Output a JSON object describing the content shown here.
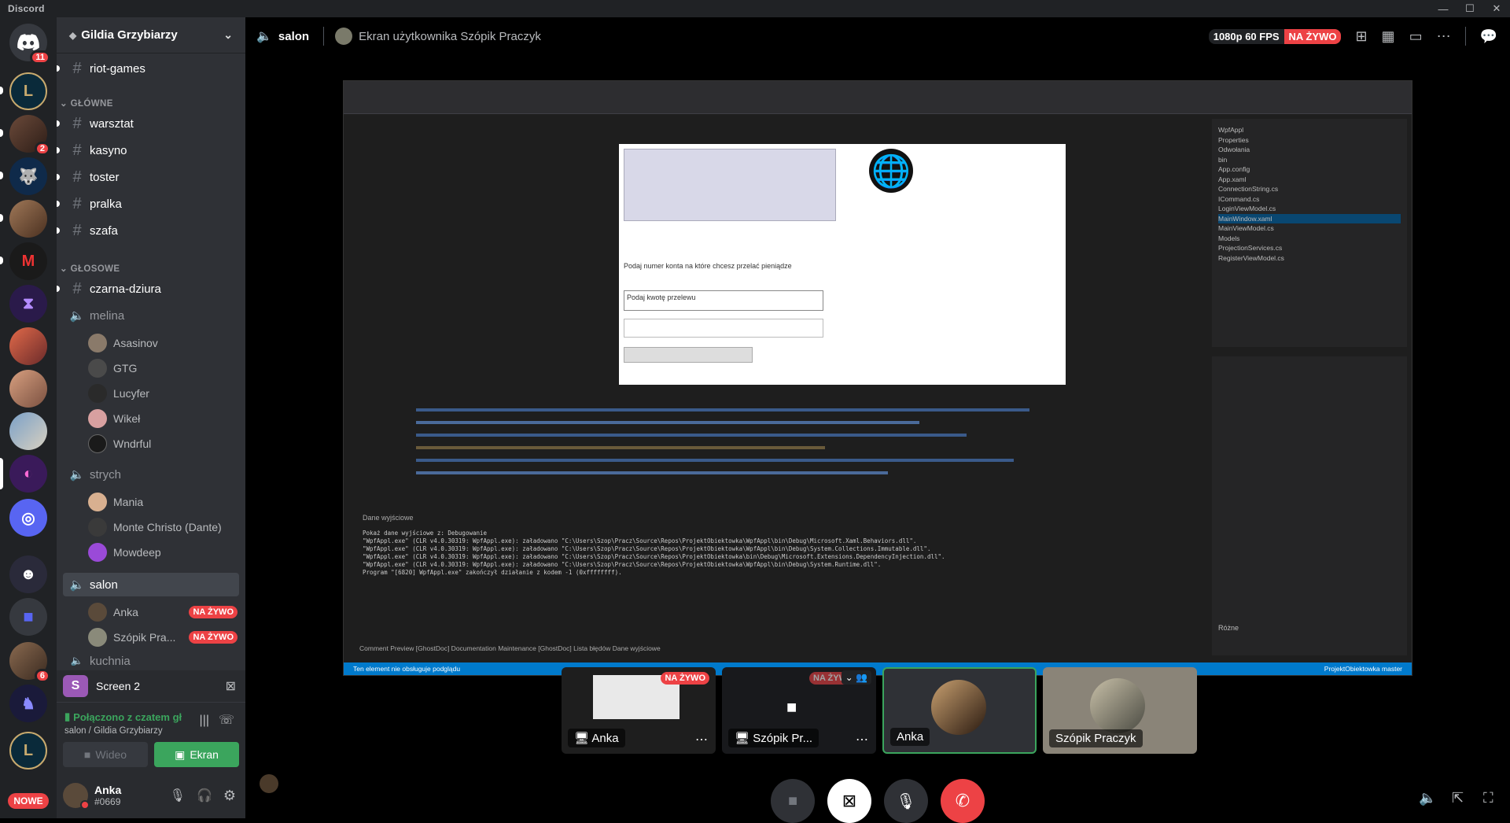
{
  "app": {
    "title": "Discord"
  },
  "guilds": {
    "home_badge": "11",
    "badge_2": "2",
    "badge_6": "6",
    "new_label": "NOWE"
  },
  "server": {
    "name": "Gildia Grzybiarzy"
  },
  "channels": {
    "top": [
      {
        "name": "riot-games"
      }
    ],
    "cat_main": "GŁÓWNE",
    "main": [
      {
        "name": "warsztat"
      },
      {
        "name": "kasyno"
      },
      {
        "name": "toster"
      },
      {
        "name": "pralka"
      },
      {
        "name": "szafa"
      }
    ],
    "cat_voice": "GŁOSOWE",
    "voice_text": {
      "name": "czarna-dziura"
    },
    "melina": {
      "name": "melina",
      "users": [
        "Asasinov",
        "GTG",
        "Lucyfer",
        "Wikeł",
        "Wndrful"
      ]
    },
    "strych": {
      "name": "strych",
      "users": [
        "Mania",
        "Monte Christo (Dante)",
        "Mowdeep"
      ]
    },
    "salon": {
      "name": "salon",
      "users": [
        {
          "name": "Anka",
          "live": "NA ŻYWO"
        },
        {
          "name": "Szópik Pra...",
          "live": "NA ŻYWO"
        }
      ]
    },
    "cut": "kuchnia"
  },
  "screen_share": {
    "title": "Screen 2",
    "icon_letter": "S"
  },
  "voice": {
    "status": "Połączono z czatem gł",
    "location": "salon / Gildia Grzybiarzy",
    "video_label": "Wideo",
    "screen_label": "Ekran"
  },
  "user": {
    "name": "Anka",
    "tag": "#0669"
  },
  "topbar": {
    "channel": "salon",
    "stream_title": "Ekran użytkownika Szópik Praczyk",
    "quality": "1080p 60 FPS",
    "live": "NA ŻYWO"
  },
  "tiles": [
    {
      "name": "Anka",
      "live": "NA ŻYWO"
    },
    {
      "name": "Szópik Pr...",
      "live": "NA ŻYW"
    },
    {
      "name": "Anka"
    },
    {
      "name": "Szópik Praczyk"
    }
  ],
  "stream_content": {
    "prompt1": "Podaj numer konta na które chcesz przelać pieniądze",
    "prompt2": "Podaj kwotę przelewu",
    "output_title": "Dane wyjściowe",
    "output_lines": [
      "Pokaż dane wyjściowe z: Debugowanie",
      "\"WpfAppl.exe\" (CLR v4.0.30319: WpfAppl.exe): załadowano \"C:\\Users\\Szop\\Pracz\\Source\\Repos\\ProjektObiektowka\\WpfAppl\\bin\\Debug\\Microsoft.Xaml.Behaviors.dll\".",
      "\"WpfAppl.exe\" (CLR v4.0.30319: WpfAppl.exe): załadowano \"C:\\Users\\Szop\\Pracz\\Source\\Repos\\ProjektObiektowka\\WpfAppl\\bin\\Debug\\System.Collections.Immutable.dll\".",
      "\"WpfAppl.exe\" (CLR v4.0.30319: WpfAppl.exe): załadowano \"C:\\Users\\Szop\\Pracz\\Source\\Repos\\ProjektObiektowka\\bin\\Debug\\Microsoft.Extensions.DependencyInjection.dll\".",
      "\"WpfAppl.exe\" (CLR v4.0.30319: WpfAppl.exe): załadowano \"C:\\Users\\Szop\\Pracz\\Source\\Repos\\ProjektObiektowka\\WpfAppl\\bin\\Debug\\System.Runtime.dll\".",
      "Program \"[6820] WpfAppl.exe\" zakończył działanie z kodem -1 (0xffffffff)."
    ],
    "bottom_tabs": "Comment Preview [GhostDoc]   Documentation Maintenance [GhostDoc]   Lista błędów   Dane wyjściowe",
    "status_left": "Ten element nie obsługuje podglądu",
    "status_right": "ProjektObiektowka   master",
    "solution_items": [
      "WpfAppl",
      "Properties",
      "Odwołania",
      "bin",
      "App.config",
      "App.xaml",
      "ConnectionString.cs",
      "ICommand.cs",
      "LoginViewModel.cs",
      "MainWindow.xaml",
      "MainViewModel.cs",
      "Models",
      "ProjectionServices.cs",
      "RegisterViewModel.cs"
    ],
    "properties_label": "Różne"
  }
}
